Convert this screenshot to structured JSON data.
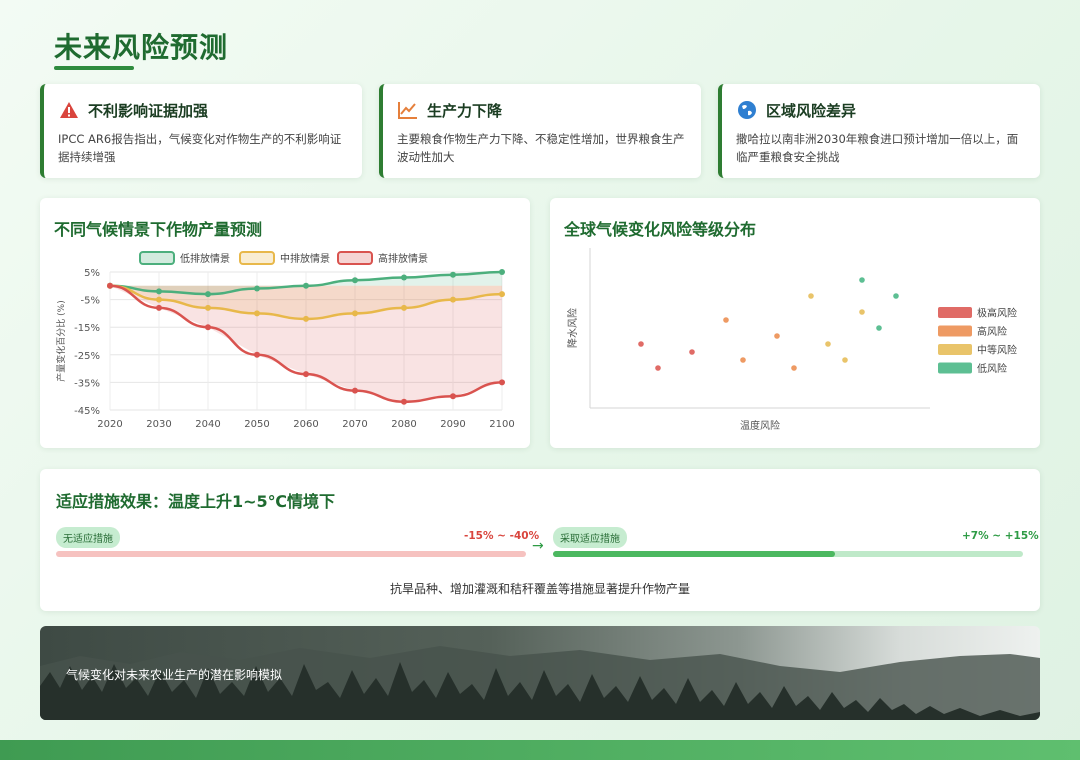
{
  "page": {
    "title": "未来风险预测"
  },
  "cards": [
    {
      "title": "不利影响证据加强",
      "desc": "IPCC AR6报告指出，气候变化对作物生产的不利影响证据持续增强",
      "icon": "warning-icon",
      "color": "#d9453d"
    },
    {
      "title": "生产力下降",
      "desc": "主要粮食作物生产力下降、不稳定性增加，世界粮食生产波动性加大",
      "icon": "trend-chart-icon",
      "color": "#e57f3b"
    },
    {
      "title": "区域风险差异",
      "desc": "撒哈拉以南非洲2030年粮食进口预计增加一倍以上，面临严重粮食安全挑战",
      "icon": "globe-icon",
      "color": "#2f7fd1"
    }
  ],
  "chart_data": [
    {
      "type": "line",
      "title": "不同气候情景下作物产量预测",
      "xlabel": "",
      "ylabel": "产量变化百分比 (%)",
      "x": [
        "2020",
        "2030",
        "2040",
        "2050",
        "2060",
        "2070",
        "2080",
        "2090",
        "2100"
      ],
      "ylim": [
        -45,
        5
      ],
      "yticks": [
        "5%",
        "-5%",
        "-15%",
        "-25%",
        "-35%",
        "-45%"
      ],
      "ytick_values": [
        5,
        -5,
        -15,
        -25,
        -35,
        -45
      ],
      "legend_position": "top",
      "grid": true,
      "series": [
        {
          "name": "低排放情景",
          "color": "#4caf7d",
          "values": [
            0,
            -2,
            -3,
            -1,
            0,
            2,
            3,
            4,
            5
          ]
        },
        {
          "name": "中排放情景",
          "color": "#e8b84a",
          "values": [
            0,
            -5,
            -8,
            -10,
            -12,
            -10,
            -8,
            -5,
            -3
          ]
        },
        {
          "name": "高排放情景",
          "color": "#d9534f",
          "values": [
            0,
            -8,
            -15,
            -25,
            -32,
            -38,
            -42,
            -40,
            -35
          ]
        }
      ]
    },
    {
      "type": "scatter",
      "title": "全球气候变化风险等级分布",
      "xlabel": "温度风险",
      "ylabel": "降水风险",
      "xlim": [
        0,
        10
      ],
      "ylim": [
        0,
        10
      ],
      "legend_position": "right",
      "grid": false,
      "series": [
        {
          "name": "极高风险",
          "color": "#e06b66",
          "points": [
            [
              1.5,
              4
            ],
            [
              2,
              2.5
            ],
            [
              3,
              3.5
            ]
          ]
        },
        {
          "name": "高风险",
          "color": "#ee9a63",
          "points": [
            [
              4,
              5.5
            ],
            [
              4.5,
              3
            ],
            [
              5.5,
              4.5
            ],
            [
              6,
              2.5
            ]
          ]
        },
        {
          "name": "中等风险",
          "color": "#e9c46a",
          "points": [
            [
              6.5,
              7
            ],
            [
              7,
              4
            ],
            [
              7.5,
              3
            ],
            [
              8,
              6
            ]
          ]
        },
        {
          "name": "低风险",
          "color": "#5dbf93",
          "points": [
            [
              8,
              8
            ],
            [
              8.5,
              5
            ],
            [
              9,
              7
            ]
          ]
        }
      ]
    }
  ],
  "adaptation": {
    "title": "适应措施效果：温度上升1~5℃情境下",
    "left": {
      "label": "无适应措施",
      "range": "-15% ~ -40%",
      "color": "#d9453d"
    },
    "right": {
      "label": "采取适应措施",
      "range": "+7% ~ +15%",
      "color": "#2e9b45",
      "fill": 0.6
    },
    "arrow": "→",
    "note": "抗旱品种、增加灌溉和秸秆覆盖等措施显著提升作物产量"
  },
  "banner": {
    "caption": "气候变化对未来农业生产的潜在影响模拟"
  }
}
